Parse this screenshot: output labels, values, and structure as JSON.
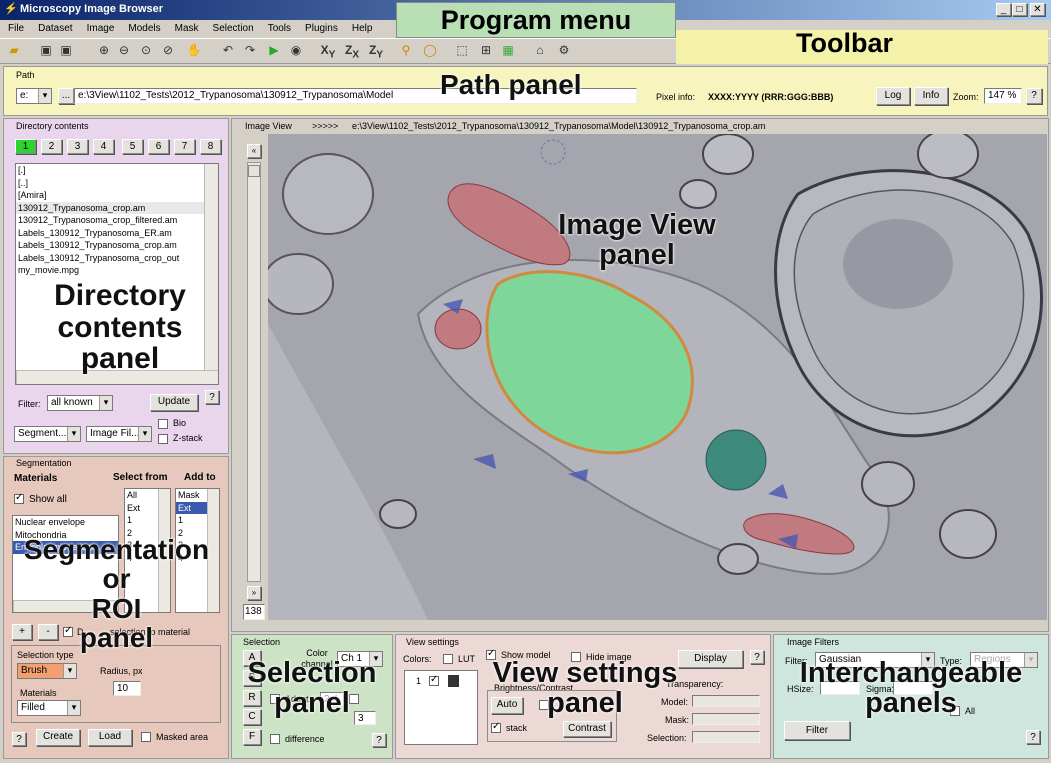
{
  "window": {
    "title": "Microscopy Image Browser",
    "controls": [
      "_",
      "□",
      "✕"
    ]
  },
  "menu": [
    "File",
    "Dataset",
    "Image",
    "Models",
    "Mask",
    "Selection",
    "Tools",
    "Plugins",
    "Help"
  ],
  "labels": {
    "program_menu": "Program menu",
    "toolbar": "Toolbar",
    "path_panel": "Path panel",
    "directory_panel": "Directory\ncontents\npanel",
    "image_view_panel": "Image View\npanel",
    "segmentation_panel": "Segmentation\nor\nROI\npanel",
    "selection_panel": "Selection\npanel",
    "view_settings_panel": "View settings\npanel",
    "interchangeable_panels": "Interchangeable\npanels"
  },
  "path": {
    "title": "Path",
    "drive": "e:",
    "dots": "...",
    "value": "e:\\3View\\1102_Tests\\2012_Trypanosoma\\130912_Trypanosoma\\Model",
    "pixel_info_label": "Pixel info:",
    "pixel_info_value": "XXXX:YYYY (RRR:GGG:BBB)",
    "log": "Log",
    "info": "Info",
    "zoom_label": "Zoom:",
    "zoom_value": "147 %",
    "help": "?"
  },
  "directory": {
    "title": "Directory contents",
    "tabs": [
      "1",
      "2",
      "3",
      "4",
      "5",
      "6",
      "7",
      "8"
    ],
    "files": [
      "[.]",
      "[..]",
      "[Amira]",
      "130912_Trypanosoma_crop.am",
      "130912_Trypanosoma_crop_filtered.am",
      "Labels_130912_Trypanosoma_ER.am",
      "Labels_130912_Trypanosoma_crop.am",
      "Labels_130912_Trypanosoma_crop_out",
      "my_movie.mpg"
    ],
    "filter_label": "Filter:",
    "filter_value": "all known",
    "update": "Update",
    "help": "?",
    "segment_dd": "Segment...",
    "imagefil_dd": "Image Fil...",
    "bio": "Bio",
    "zstack": "Z-stack"
  },
  "image_view": {
    "title": "Image View",
    "arrows": ">>>>>",
    "path": "e:\\3View\\1102_Tests\\2012_Trypanosoma\\130912_Trypanosoma\\Model\\130912_Trypanosoma_crop.am",
    "slice": "138"
  },
  "segmentation": {
    "title": "Segmentation",
    "materials_label": "Materials",
    "select_from": "Select from",
    "add_to": "Add to",
    "show_all": "Show all",
    "materials": [
      "Nuclear envelope",
      "Mitochondria",
      "",
      "Endoplasmic reticul..."
    ],
    "select_list": [
      "All",
      "Ext",
      "1",
      "2",
      "3",
      "4"
    ],
    "add_list": [
      "Mask",
      "Ext",
      "1",
      "2",
      "3",
      "4"
    ],
    "plus": "+",
    "minus": "-",
    "d_label": "D",
    "selection_to_material": "selection to material",
    "selection_type_label": "Selection type",
    "selection_type_value": "Brush",
    "radius_label": "Radius, px",
    "radius_value": "10",
    "materials2_label": "Materials",
    "materials2_value": "Filled",
    "help": "?",
    "create": "Create",
    "load": "Load",
    "masked_area": "Masked area"
  },
  "selection": {
    "title": "Selection",
    "buttons": [
      "A",
      "S",
      "R",
      "C",
      "F"
    ],
    "color_channel_label": "Color channel",
    "color_channel_value": "Ch 1",
    "adapt": "Adapt.",
    "adapt_value": "2.4",
    "value3": "3",
    "difference": "difference",
    "help": "?"
  },
  "view_settings": {
    "title": "View settings",
    "colors_label": "Colors:",
    "lut": "LUT",
    "show_model": "Show model",
    "hide_image": "Hide image",
    "display": "Display",
    "help": "?",
    "row_num": "1",
    "brightness": "Brightness/Contrast",
    "auto": "Auto",
    "stack": "stack",
    "contrast": "Contrast",
    "transparency": "Transparency:",
    "model": "Model:",
    "mask": "Mask:",
    "selection": "Selection:"
  },
  "filters": {
    "title": "Image Filters",
    "filter_label": "Filter:",
    "filter_value": "Gaussian",
    "type_label": "Type:",
    "type_value": "Regions",
    "hsize": "HSize:",
    "sigma": "Sigma:",
    "all": "All",
    "filter_btn": "Filter",
    "help": "?"
  },
  "colors": {
    "menu_label_bg": "#b9e0b4",
    "toolbar_label_bg": "#f4f2a8",
    "path_bg": "#f7f4bd",
    "dir_bg": "#ead6ec",
    "seg_bg": "#e6c8bc",
    "sel_bg": "#cde3c6",
    "view_bg": "#ecd8d4",
    "filt_bg": "#cfe6df",
    "title_grad_a": "#0a246a",
    "title_grad_b": "#a6caf0"
  }
}
